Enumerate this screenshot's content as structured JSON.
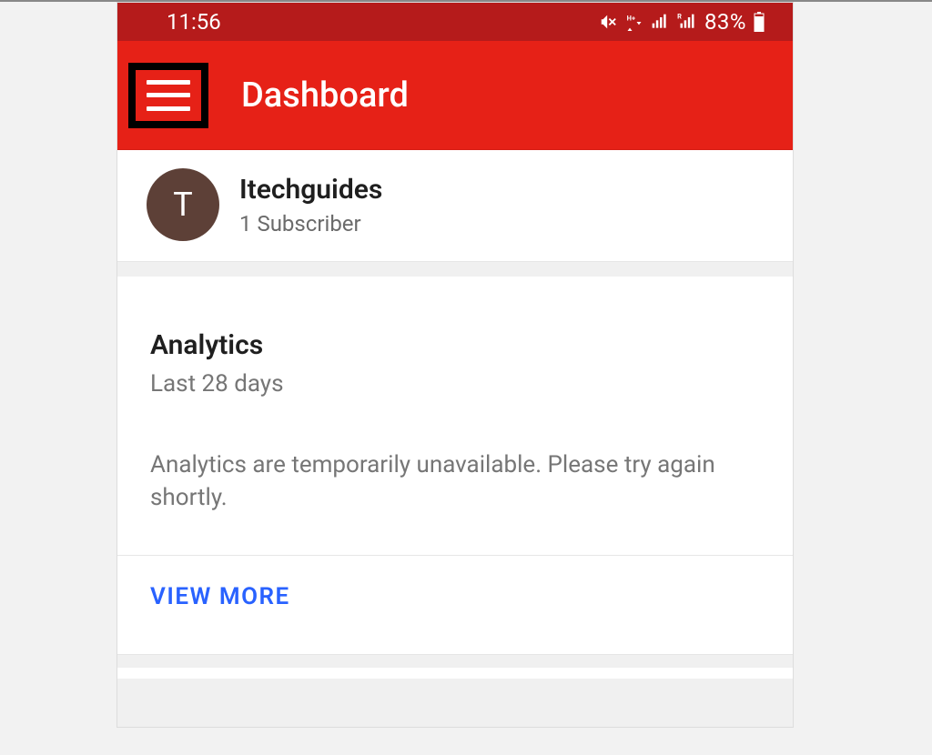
{
  "statusbar": {
    "time": "11:56",
    "battery_pct": "83%"
  },
  "appbar": {
    "title": "Dashboard"
  },
  "channel": {
    "avatar_letter": "T",
    "name": "Itechguides",
    "sub": "1 Subscriber"
  },
  "analytics": {
    "title": "Analytics",
    "subtitle": "Last 28 days",
    "message": "Analytics are temporarily unavailable. Please try again shortly.",
    "viewmore": "VIEW MORE"
  }
}
